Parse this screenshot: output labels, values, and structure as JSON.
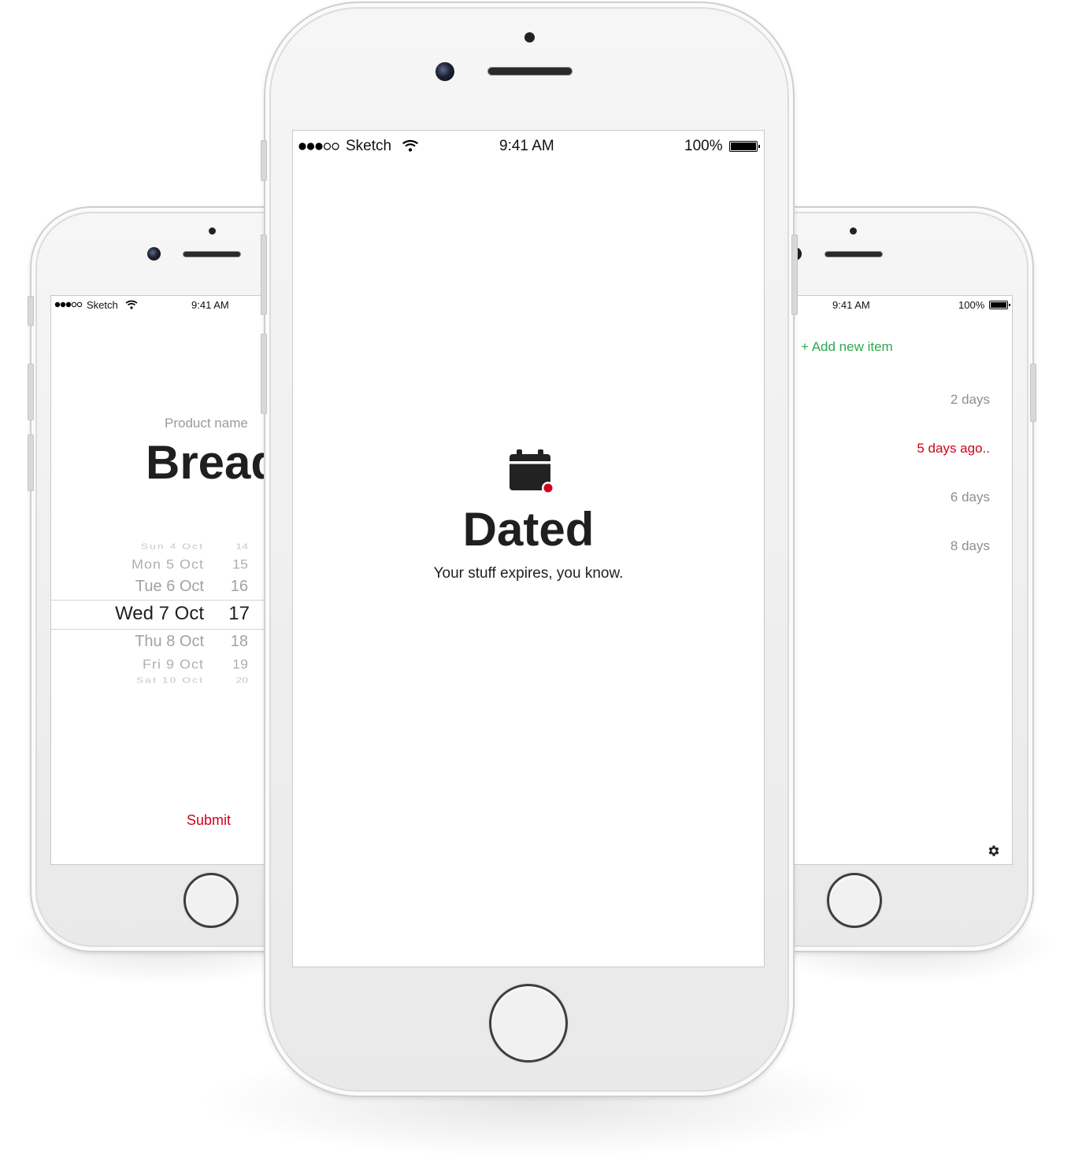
{
  "status_bar": {
    "carrier": "Sketch",
    "time": "9:41 AM",
    "battery": "100%"
  },
  "left_screen": {
    "product_label": "Product name",
    "product_value": "Bread",
    "picker": [
      {
        "date": "Sun 4 Oct",
        "num": "14",
        "level": 3
      },
      {
        "date": "Mon 5 Oct",
        "num": "15",
        "level": 2
      },
      {
        "date": "Tue 6 Oct",
        "num": "16",
        "level": 1
      },
      {
        "date": "Wed 7 Oct",
        "num": "17",
        "level": 0
      },
      {
        "date": "Thu 8 Oct",
        "num": "18",
        "level": 1
      },
      {
        "date": "Fri 9 Oct",
        "num": "19",
        "level": 2
      },
      {
        "date": "Sat 10 Oct",
        "num": "20",
        "level": 3
      }
    ],
    "submit_label": "Submit"
  },
  "center_screen": {
    "app_name": "Dated",
    "tagline": "Your stuff expires, you know."
  },
  "right_screen": {
    "add_label": "+ Add new item",
    "items": [
      {
        "days": "2 days",
        "overdue": false
      },
      {
        "days": "5 days ago..",
        "overdue": true
      },
      {
        "days": "6 days",
        "overdue": false
      },
      {
        "days": "8 days",
        "overdue": false
      }
    ],
    "settings_icon": "gear-icon"
  },
  "colors": {
    "accent_red": "#d0021b",
    "add_green": "#2fa84f",
    "gray_text": "#8e8e8e",
    "dark_text": "#222222"
  }
}
